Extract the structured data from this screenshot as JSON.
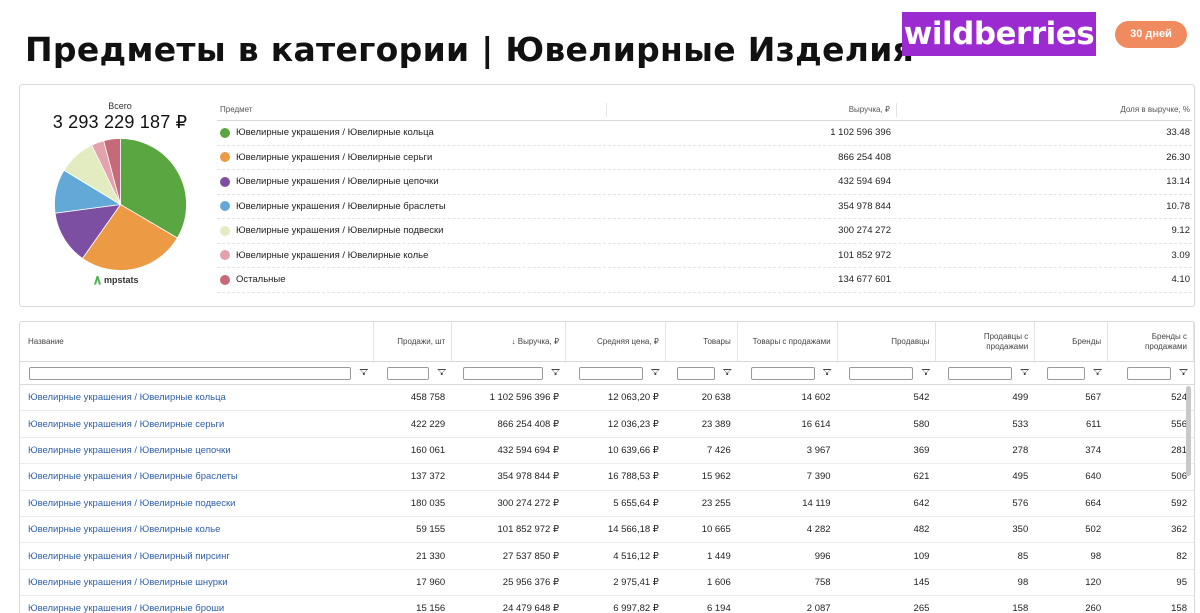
{
  "header": {
    "title": "Предметы в категории | Ювелирные Изделия",
    "brand": "wildberries",
    "period": "30 дней"
  },
  "summary": {
    "total_label": "Всего",
    "total_value": "3 293 229 187 ₽",
    "source_logo": "mpstats",
    "columns": {
      "name": "Предмет",
      "revenue": "Выручка, ₽",
      "share": "Доля в выручке, %"
    },
    "rows": [
      {
        "name": "Ювелирные украшения / Ювелирные кольца",
        "revenue": "1 102 596 396",
        "share": "33.48",
        "color": "#5aa640"
      },
      {
        "name": "Ювелирные украшения / Ювелирные серьги",
        "revenue": "866 254 408",
        "share": "26.30",
        "color": "#ed9a44"
      },
      {
        "name": "Ювелирные украшения / Ювелирные цепочки",
        "revenue": "432 594 694",
        "share": "13.14",
        "color": "#7d4fa3"
      },
      {
        "name": "Ювелирные украшения / Ювелирные браслеты",
        "revenue": "354 978 844",
        "share": "10.78",
        "color": "#62a9d8"
      },
      {
        "name": "Ювелирные украшения / Ювелирные подвески",
        "revenue": "300 274 272",
        "share": "9.12",
        "color": "#e3ecc0"
      },
      {
        "name": "Ювелирные украшения / Ювелирные колье",
        "revenue": "101 852 972",
        "share": "3.09",
        "color": "#e3a3ad"
      },
      {
        "name": "Остальные",
        "revenue": "134 677 601",
        "share": "4.10",
        "color": "#c66a7a"
      }
    ]
  },
  "chart_data": {
    "type": "pie",
    "title": "",
    "categories": [
      "Ювелирные украшения / Ювелирные кольца",
      "Ювелирные украшения / Ювелирные серьги",
      "Ювелирные украшения / Ювелирные цепочки",
      "Ювелирные украшения / Ювелирные браслеты",
      "Ювелирные украшения / Ювелирные подвески",
      "Ювелирные украшения / Ювелирные колье",
      "Остальные"
    ],
    "values": [
      33.48,
      26.3,
      13.14,
      10.78,
      9.12,
      3.09,
      4.1
    ],
    "colors": [
      "#5aa640",
      "#ed9a44",
      "#7d4fa3",
      "#62a9d8",
      "#e3ecc0",
      "#e3a3ad",
      "#c66a7a"
    ]
  },
  "table": {
    "columns": [
      "Название",
      "Продажи, шт",
      "↓ Выручка, ₽",
      "Средняя цена, ₽",
      "Товары",
      "Товары с продажами",
      "Продавцы",
      "Продавцы с продажами",
      "Бренды",
      "Бренды с продажами"
    ],
    "rows": [
      [
        "Ювелирные украшения / Ювелирные кольца",
        "458 758",
        "1 102 596 396 ₽",
        "12 063,20 ₽",
        "20 638",
        "14 602",
        "542",
        "499",
        "567",
        "524"
      ],
      [
        "Ювелирные украшения / Ювелирные серьги",
        "422 229",
        "866 254 408 ₽",
        "12 036,23 ₽",
        "23 389",
        "16 614",
        "580",
        "533",
        "611",
        "556"
      ],
      [
        "Ювелирные украшения / Ювелирные цепочки",
        "160 061",
        "432 594 694 ₽",
        "10 639,66 ₽",
        "7 426",
        "3 967",
        "369",
        "278",
        "374",
        "281"
      ],
      [
        "Ювелирные украшения / Ювелирные браслеты",
        "137 372",
        "354 978 844 ₽",
        "16 788,53 ₽",
        "15 962",
        "7 390",
        "621",
        "495",
        "640",
        "506"
      ],
      [
        "Ювелирные украшения / Ювелирные подвески",
        "180 035",
        "300 274 272 ₽",
        "5 655,64 ₽",
        "23 255",
        "14 119",
        "642",
        "576",
        "664",
        "592"
      ],
      [
        "Ювелирные украшения / Ювелирные колье",
        "59 155",
        "101 852 972 ₽",
        "14 566,18 ₽",
        "10 665",
        "4 282",
        "482",
        "350",
        "502",
        "362"
      ],
      [
        "Ювелирные украшения / Ювелирный пирсинг",
        "21 330",
        "27 537 850 ₽",
        "4 516,12 ₽",
        "1 449",
        "996",
        "109",
        "85",
        "98",
        "82"
      ],
      [
        "Ювелирные украшения / Ювелирные шнурки",
        "17 960",
        "25 956 376 ₽",
        "2 975,41 ₽",
        "1 606",
        "758",
        "145",
        "98",
        "120",
        "95"
      ],
      [
        "Ювелирные украшения / Ювелирные броши",
        "15 156",
        "24 479 648 ₽",
        "6 997,82 ₽",
        "6 194",
        "2 087",
        "265",
        "158",
        "260",
        "158"
      ]
    ]
  }
}
